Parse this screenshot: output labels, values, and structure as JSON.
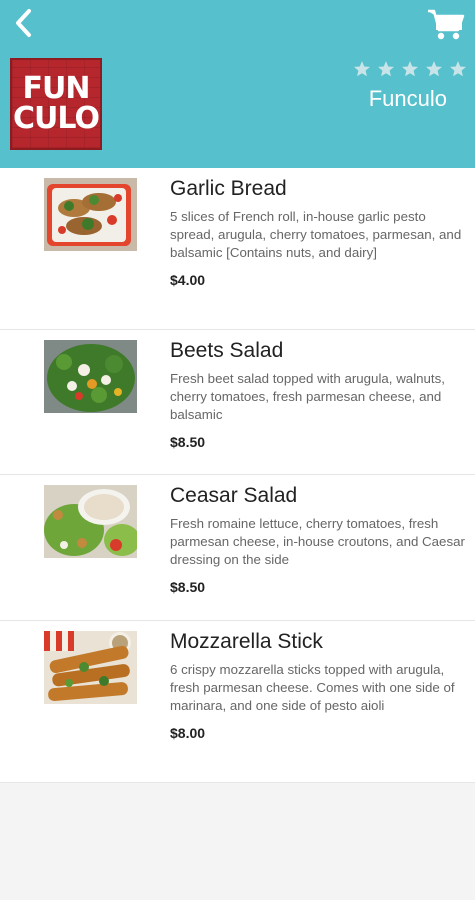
{
  "header": {
    "back_icon": "chevron-left-icon",
    "cart_icon": "shopping-cart-icon",
    "logo_text": [
      "FUN",
      "CULO"
    ],
    "rating_stars": 5,
    "rating_filled": 0,
    "restaurant_name": "Funculo",
    "colors": {
      "header_bg": "#56c0cc",
      "logo_bg": "#b6262d",
      "star": "#c9e4e8"
    }
  },
  "menu": {
    "items": [
      {
        "name": "Garlic Bread",
        "description": "5 slices of French roll, in-house garlic pesto spread, arugula, cherry tomatoes, parmesan, and balsamic [Contains nuts, and dairy]",
        "price": "$4.00"
      },
      {
        "name": "Beets Salad",
        "description": "Fresh beet salad topped with arugula, walnuts, cherry tomatoes, fresh parmesan cheese, and balsamic",
        "price": "$8.50"
      },
      {
        "name": "Ceasar Salad",
        "description": "Fresh romaine lettuce, cherry tomatoes, fresh parmesan cheese, in-house croutons, and Caesar dressing on the side",
        "price": "$8.50"
      },
      {
        "name": "Mozzarella Stick",
        "description": "6 crispy mozzarella sticks topped with arugula, fresh parmesan cheese. Comes with one side of marinara, and one side of pesto aioli",
        "price": "$8.00"
      }
    ]
  }
}
